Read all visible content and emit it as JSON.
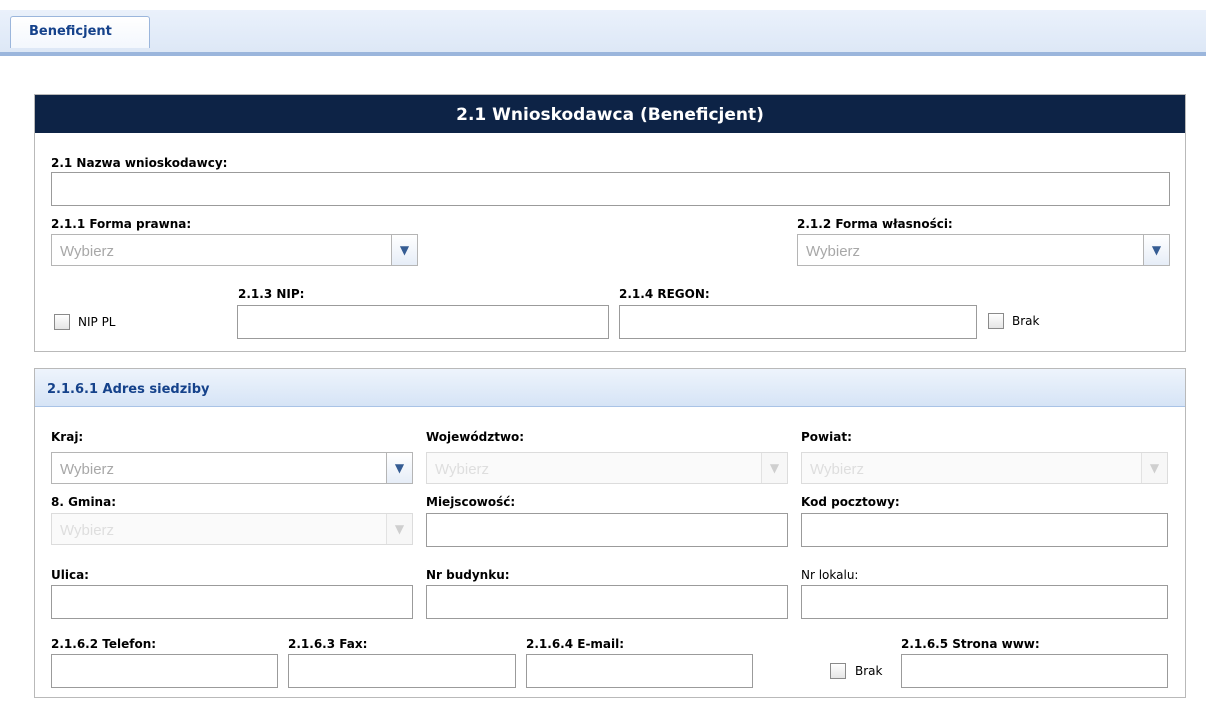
{
  "tab": {
    "label": "Beneficjent"
  },
  "section1": {
    "title": "2.1 Wnioskodawca (Beneficjent)",
    "name_label": "2.1 Nazwa wnioskodawcy:",
    "forma_prawna_label": "2.1.1 Forma prawna:",
    "forma_prawna_value": "Wybierz",
    "forma_wlasnosci_label": "2.1.2 Forma własności:",
    "forma_wlasnosci_value": "Wybierz",
    "nip_pl_label": "NIP PL",
    "nip_label": "2.1.3 NIP:",
    "regon_label": "2.1.4 REGON:",
    "brak_label": "Brak"
  },
  "address": {
    "title": "2.1.6.1 Adres siedziby",
    "kraj_label": "Kraj:",
    "kraj_value": "Wybierz",
    "wojewodztwo_label": "Województwo:",
    "wojewodztwo_value": "Wybierz",
    "powiat_label": "Powiat:",
    "powiat_value": "Wybierz",
    "gmina_label": "8. Gmina:",
    "gmina_value": "Wybierz",
    "miejscowosc_label": "Miejscowość:",
    "kod_label": "Kod pocztowy:",
    "ulica_label": "Ulica:",
    "nr_budynku_label": "Nr budynku:",
    "nr_lokalu_label": "Nr lokalu:",
    "telefon_label": "2.1.6.2 Telefon:",
    "fax_label": "2.1.6.3 Fax:",
    "email_label": "2.1.6.4 E-mail:",
    "www_label": "2.1.6.5 Strona www:",
    "www_brak_label": "Brak"
  },
  "icons": {
    "chevron": "chevron-down-icon",
    "checkbox": "checkbox-icon"
  },
  "colors": {
    "header_bg": "#0d2346",
    "accent_text": "#15428b",
    "tab_border": "#9bb6dc"
  }
}
